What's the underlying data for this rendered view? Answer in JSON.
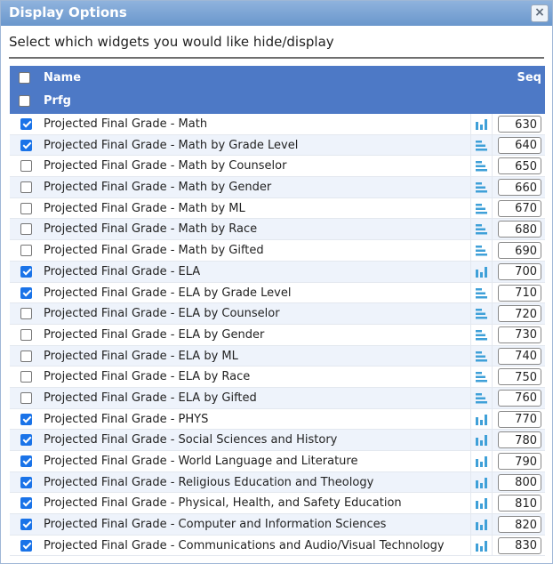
{
  "dialog": {
    "title": "Display Options",
    "close_glyph": "×",
    "instructions": "Select which widgets you would like hide/display"
  },
  "table": {
    "header_name": "Name",
    "header_seq": "Seq",
    "group_label": "Prfg",
    "accent_color": "#4d79c6"
  },
  "rows": [
    {
      "label": "Projected Final Grade - Math",
      "checked": true,
      "icon": "bar-chart-icon",
      "seq": "630"
    },
    {
      "label": "Projected Final Grade - Math by Grade Level",
      "checked": true,
      "icon": "hbar-chart-icon",
      "seq": "640"
    },
    {
      "label": "Projected Final Grade - Math by Counselor",
      "checked": false,
      "icon": "hbar-chart-icon",
      "seq": "650"
    },
    {
      "label": "Projected Final Grade - Math by Gender",
      "checked": false,
      "icon": "hbar-chart-icon",
      "seq": "660"
    },
    {
      "label": "Projected Final Grade - Math by ML",
      "checked": false,
      "icon": "hbar-chart-icon",
      "seq": "670"
    },
    {
      "label": "Projected Final Grade - Math by Race",
      "checked": false,
      "icon": "hbar-chart-icon",
      "seq": "680"
    },
    {
      "label": "Projected Final Grade - Math by Gifted",
      "checked": false,
      "icon": "hbar-chart-icon",
      "seq": "690"
    },
    {
      "label": "Projected Final Grade - ELA",
      "checked": true,
      "icon": "bar-chart-icon",
      "seq": "700"
    },
    {
      "label": "Projected Final Grade - ELA by Grade Level",
      "checked": true,
      "icon": "hbar-chart-icon",
      "seq": "710"
    },
    {
      "label": "Projected Final Grade - ELA by Counselor",
      "checked": false,
      "icon": "hbar-chart-icon",
      "seq": "720"
    },
    {
      "label": "Projected Final Grade - ELA by Gender",
      "checked": false,
      "icon": "hbar-chart-icon",
      "seq": "730"
    },
    {
      "label": "Projected Final Grade - ELA by ML",
      "checked": false,
      "icon": "hbar-chart-icon",
      "seq": "740"
    },
    {
      "label": "Projected Final Grade - ELA by Race",
      "checked": false,
      "icon": "hbar-chart-icon",
      "seq": "750"
    },
    {
      "label": "Projected Final Grade - ELA by Gifted",
      "checked": false,
      "icon": "hbar-chart-icon",
      "seq": "760"
    },
    {
      "label": "Projected Final Grade - PHYS",
      "checked": true,
      "icon": "bar-chart-icon",
      "seq": "770"
    },
    {
      "label": "Projected Final Grade - Social Sciences and History",
      "checked": true,
      "icon": "bar-chart-icon",
      "seq": "780"
    },
    {
      "label": "Projected Final Grade - World Language and Literature",
      "checked": true,
      "icon": "bar-chart-icon",
      "seq": "790"
    },
    {
      "label": "Projected Final Grade - Religious Education and Theology",
      "checked": true,
      "icon": "bar-chart-icon",
      "seq": "800"
    },
    {
      "label": "Projected Final Grade - Physical, Health, and Safety Education",
      "checked": true,
      "icon": "bar-chart-icon",
      "seq": "810"
    },
    {
      "label": "Projected Final Grade - Computer and Information Sciences",
      "checked": true,
      "icon": "bar-chart-icon",
      "seq": "820"
    },
    {
      "label": "Projected Final Grade - Communications and Audio/Visual Technology",
      "checked": true,
      "icon": "bar-chart-icon",
      "seq": "830"
    }
  ]
}
